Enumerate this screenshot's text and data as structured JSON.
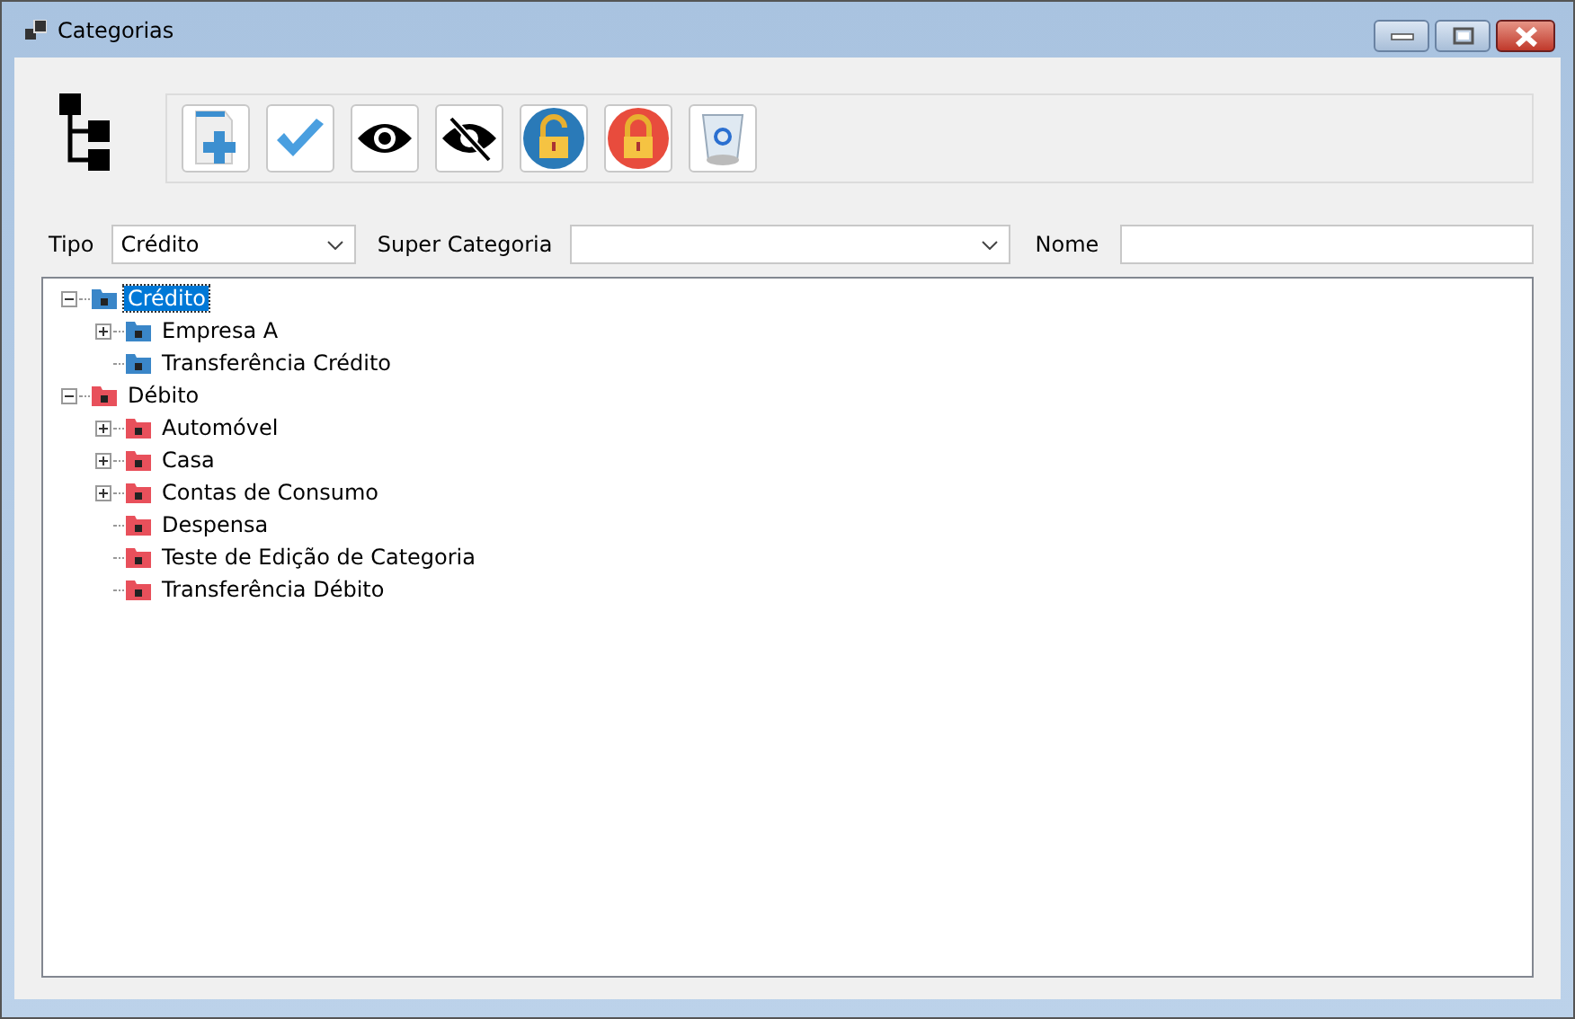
{
  "window": {
    "title": "Categorias"
  },
  "toolbar": {
    "buttons": [
      {
        "kind": "new"
      },
      {
        "kind": "confirm"
      },
      {
        "kind": "show"
      },
      {
        "kind": "hide"
      },
      {
        "kind": "unlock"
      },
      {
        "kind": "lock"
      },
      {
        "kind": "delete"
      }
    ]
  },
  "filters": {
    "tipo_label": "Tipo",
    "tipo_value": "Crédito",
    "super_label": "Super Categoria",
    "nome_label": "Nome"
  },
  "tree": [
    {
      "label": "Crédito",
      "color": "#3a86c8",
      "expanded": true,
      "selected": true,
      "children": [
        {
          "label": "Empresa A",
          "expanded": false,
          "selected": false
        },
        {
          "label": "Transferência Crédito",
          "selected": false
        }
      ]
    },
    {
      "label": "Débito",
      "color": "#e8505b",
      "expanded": true,
      "selected": false,
      "children": [
        {
          "label": "Automóvel",
          "expanded": false,
          "selected": false
        },
        {
          "label": "Casa",
          "expanded": false,
          "selected": false
        },
        {
          "label": "Contas de Consumo",
          "expanded": false,
          "selected": false
        },
        {
          "label": "Despensa",
          "selected": false
        },
        {
          "label": "Teste de Edição de Categoria",
          "selected": false
        },
        {
          "label": "Transferência Débito",
          "selected": false
        }
      ]
    }
  ]
}
